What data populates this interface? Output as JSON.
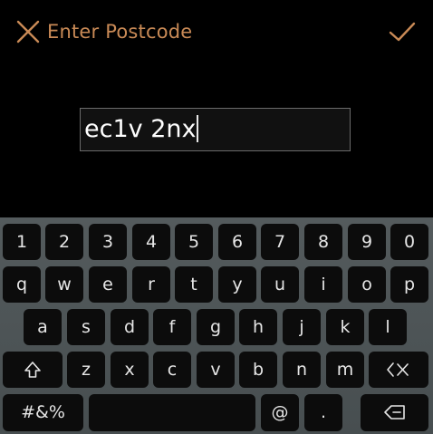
{
  "header": {
    "title": "Enter Postcode",
    "accent_color": "#c98a56",
    "close_icon": "close-icon",
    "confirm_icon": "checkmark-icon"
  },
  "input": {
    "value": "ec1v 2nx"
  },
  "keyboard": {
    "row1": [
      "1",
      "2",
      "3",
      "4",
      "5",
      "6",
      "7",
      "8",
      "9",
      "0"
    ],
    "row2": [
      "q",
      "w",
      "e",
      "r",
      "t",
      "y",
      "u",
      "i",
      "o",
      "p"
    ],
    "row3": [
      "a",
      "s",
      "d",
      "f",
      "g",
      "h",
      "j",
      "k",
      "l"
    ],
    "row4": [
      "z",
      "x",
      "c",
      "v",
      "b",
      "n",
      "m"
    ],
    "symbols_label": "#&%",
    "at_label": "@",
    "period_label": ".",
    "shift_icon": "shift-icon",
    "delete_icon": "delete-icon",
    "backspace_icon": "backspace-icon"
  }
}
